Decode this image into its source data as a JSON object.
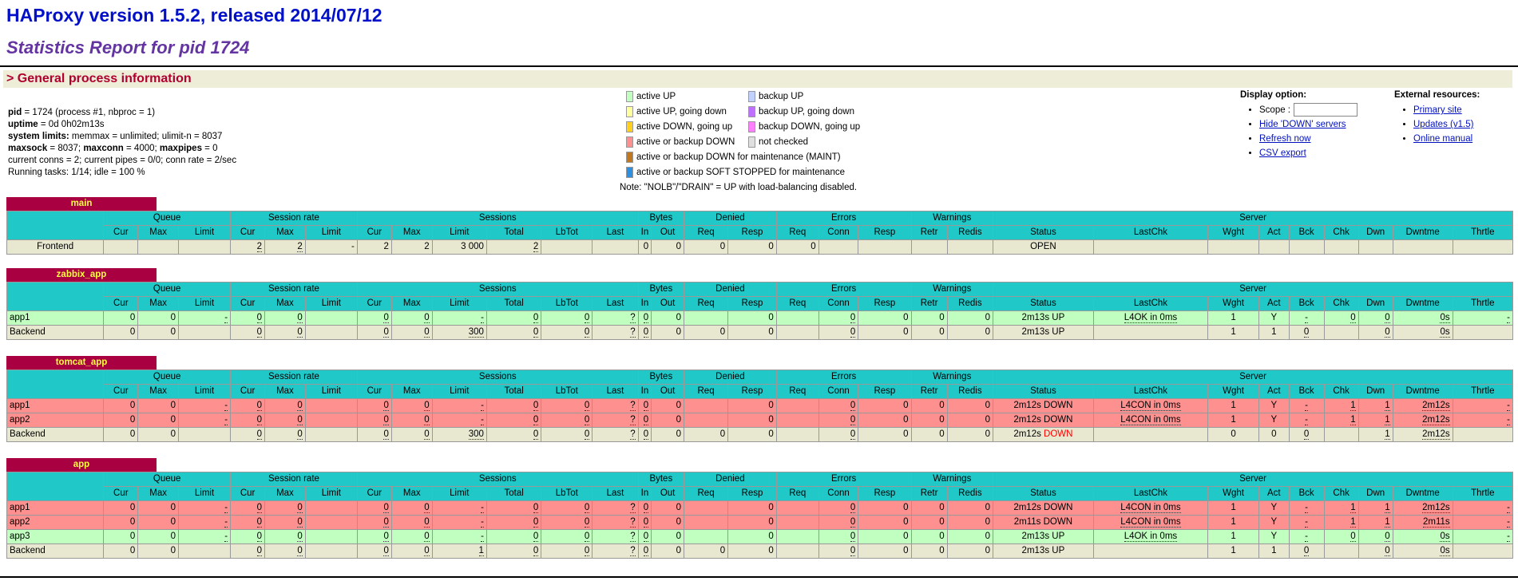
{
  "title": "HAProxy version 1.5.2, released 2014/07/12",
  "subtitle": "Statistics Report for pid 1724",
  "general_header": "> General process information",
  "info": [
    {
      "b": "pid",
      "r": " = 1724 (process #1, nbproc = 1)"
    },
    {
      "b": "uptime",
      "r": " = 0d 0h02m13s"
    },
    {
      "b": "system limits:",
      "r": " memmax = unlimited; ulimit-n = 8037"
    },
    {
      "b": "maxsock",
      "r": " = 8037; ",
      "b2": "maxconn",
      "r2": " = 4000; ",
      "b3": "maxpipes",
      "r3": " = 0"
    },
    {
      "b": "",
      "r": "current conns = 2; current pipes = 0/0; conn rate = 2/sec"
    },
    {
      "b": "",
      "r": "Running tasks: 1/14; idle = 100 %"
    }
  ],
  "legend": {
    "left": [
      {
        "label": "active UP",
        "color": "#c0ffc0"
      },
      {
        "label": "active UP, going down",
        "color": "#ffffa0"
      },
      {
        "label": "active DOWN, going up",
        "color": "#ffd020"
      },
      {
        "label": "active or backup DOWN",
        "color": "#ff9090"
      },
      {
        "label": "active or backup DOWN for maintenance (MAINT)",
        "color": "#c07820"
      },
      {
        "label": "active or backup SOFT STOPPED for maintenance",
        "color": "#3090e0"
      }
    ],
    "right": [
      {
        "label": "backup UP",
        "color": "#c0d0ff"
      },
      {
        "label": "backup UP, going down",
        "color": "#c070ff"
      },
      {
        "label": "backup DOWN, going up",
        "color": "#ff80ff"
      },
      {
        "label": "not checked",
        "color": "#e0e0e0"
      }
    ],
    "note": "Note: \"NOLB\"/\"DRAIN\" = UP with load-balancing disabled."
  },
  "display": {
    "heading": "Display option:",
    "scope_label": "Scope :",
    "links": [
      "Hide 'DOWN' servers",
      "Refresh now",
      "CSV export"
    ]
  },
  "external": {
    "heading": "External resources:",
    "links": [
      "Primary site",
      "Updates (v1.5)",
      "Online manual"
    ]
  },
  "group_headers": [
    "Queue",
    "Session rate",
    "Sessions",
    "Bytes",
    "Denied",
    "Errors",
    "Warnings",
    "Server"
  ],
  "sub_headers": [
    "Cur",
    "Max",
    "Limit",
    "Cur",
    "Max",
    "Limit",
    "Cur",
    "Max",
    "Limit",
    "Total",
    "LbTot",
    "Last",
    "In",
    "Out",
    "Req",
    "Resp",
    "Req",
    "Conn",
    "Resp",
    "Retr",
    "Redis",
    "Status",
    "LastChk",
    "Wght",
    "Act",
    "Bck",
    "Chk",
    "Dwn",
    "Dwntme",
    "Thrtle"
  ],
  "colors": {
    "up": "#c0ffc0",
    "down": "#ff9090",
    "neutral": "#e8e8d0",
    "header": "#20c8c8",
    "tab": "#a80040"
  },
  "proxies": [
    {
      "name": "main",
      "rows": [
        {
          "type": "f",
          "cells": [
            "Frontend",
            "",
            "",
            "",
            "2",
            "2",
            "-",
            "2",
            "2",
            "3 000",
            "2",
            "",
            "",
            "0",
            "0",
            "0",
            "0",
            "0",
            "",
            "",
            "",
            "",
            "OPEN",
            "",
            "",
            "",
            "",
            "",
            "",
            "",
            ""
          ]
        }
      ]
    },
    {
      "name": "zabbix_app",
      "rows": [
        {
          "type": "u",
          "cells": [
            "app1",
            "0",
            "0",
            "-",
            "0",
            "0",
            "",
            "0",
            "0",
            "-",
            "0",
            "0",
            "?",
            "0",
            "0",
            "",
            "0",
            "",
            "0",
            "0",
            "0",
            "0",
            "2m13s UP",
            "L4OK in 0ms",
            "1",
            "Y",
            "-",
            "0",
            "0",
            "0s",
            "-"
          ]
        },
        {
          "type": "b",
          "cells": [
            "Backend",
            "0",
            "0",
            "",
            "0",
            "0",
            "",
            "0",
            "0",
            "300",
            "0",
            "0",
            "?",
            "0",
            "0",
            "0",
            "0",
            "",
            "0",
            "0",
            "0",
            "0",
            "2m13s UP",
            "",
            "1",
            "1",
            "0",
            "",
            "0",
            "0s",
            ""
          ]
        }
      ]
    },
    {
      "name": "tomcat_app",
      "rows": [
        {
          "type": "d",
          "cells": [
            "app1",
            "0",
            "0",
            "-",
            "0",
            "0",
            "",
            "0",
            "0",
            "-",
            "0",
            "0",
            "?",
            "0",
            "0",
            "",
            "0",
            "",
            "0",
            "0",
            "0",
            "0",
            "2m12s DOWN",
            "L4CON in 0ms",
            "1",
            "Y",
            "-",
            "1",
            "1",
            "2m12s",
            "-"
          ]
        },
        {
          "type": "d",
          "cells": [
            "app2",
            "0",
            "0",
            "-",
            "0",
            "0",
            "",
            "0",
            "0",
            "-",
            "0",
            "0",
            "?",
            "0",
            "0",
            "",
            "0",
            "",
            "0",
            "0",
            "0",
            "0",
            "2m12s DOWN",
            "L4CON in 0ms",
            "1",
            "Y",
            "-",
            "1",
            "1",
            "2m12s",
            "-"
          ]
        },
        {
          "type": "b",
          "cells": [
            "Backend",
            "0",
            "0",
            "",
            "0",
            "0",
            "",
            "0",
            "0",
            "300",
            "0",
            "0",
            "?",
            "0",
            "0",
            "0",
            "0",
            "",
            "0",
            "0",
            "0",
            "0",
            "2m12s DOWN",
            "",
            "0",
            "0",
            "0",
            "",
            "1",
            "2m12s",
            ""
          ]
        }
      ]
    },
    {
      "name": "app",
      "rows": [
        {
          "type": "d",
          "cells": [
            "app1",
            "0",
            "0",
            "-",
            "0",
            "0",
            "",
            "0",
            "0",
            "-",
            "0",
            "0",
            "?",
            "0",
            "0",
            "",
            "0",
            "",
            "0",
            "0",
            "0",
            "0",
            "2m12s DOWN",
            "L4CON in 0ms",
            "1",
            "Y",
            "-",
            "1",
            "1",
            "2m12s",
            "-"
          ]
        },
        {
          "type": "d",
          "cells": [
            "app2",
            "0",
            "0",
            "-",
            "0",
            "0",
            "",
            "0",
            "0",
            "-",
            "0",
            "0",
            "?",
            "0",
            "0",
            "",
            "0",
            "",
            "0",
            "0",
            "0",
            "0",
            "2m11s DOWN",
            "L4CON in 0ms",
            "1",
            "Y",
            "-",
            "1",
            "1",
            "2m11s",
            "-"
          ]
        },
        {
          "type": "u",
          "cells": [
            "app3",
            "0",
            "0",
            "-",
            "0",
            "0",
            "",
            "0",
            "0",
            "-",
            "0",
            "0",
            "?",
            "0",
            "0",
            "",
            "0",
            "",
            "0",
            "0",
            "0",
            "0",
            "2m13s UP",
            "L4OK in 0ms",
            "1",
            "Y",
            "-",
            "0",
            "0",
            "0s",
            "-"
          ]
        },
        {
          "type": "b",
          "cells": [
            "Backend",
            "0",
            "0",
            "",
            "0",
            "0",
            "",
            "0",
            "0",
            "1",
            "0",
            "0",
            "?",
            "0",
            "0",
            "0",
            "0",
            "",
            "0",
            "0",
            "0",
            "0",
            "2m13s UP",
            "",
            "1",
            "1",
            "0",
            "",
            "0",
            "0s",
            ""
          ]
        }
      ]
    }
  ]
}
